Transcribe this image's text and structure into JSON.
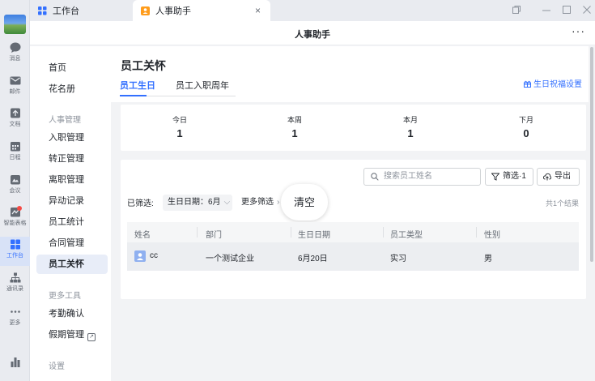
{
  "rail": {
    "items": [
      {
        "label": "消息",
        "icon": "chat-bubble-icon"
      },
      {
        "label": "邮件",
        "icon": "mail-icon"
      },
      {
        "label": "文档",
        "icon": "doc-icon"
      },
      {
        "label": "日程",
        "icon": "calendar-icon"
      },
      {
        "label": "会议",
        "icon": "video-icon"
      },
      {
        "label": "智能表格",
        "icon": "sheet-icon"
      },
      {
        "label": "工作台",
        "icon": "grid-icon",
        "active": true
      },
      {
        "label": "通讯录",
        "icon": "org-icon"
      },
      {
        "label": "更多",
        "icon": "more-dots-icon"
      }
    ]
  },
  "tabs": {
    "inactive_label": "工作台",
    "active_label": "人事助手",
    "close_symbol": "×"
  },
  "window": {
    "title": "人事助手",
    "more_symbol": "···"
  },
  "sidebar": {
    "home": "首页",
    "roster": "花名册",
    "group_hr": "人事管理",
    "onboarding": "入职管理",
    "regularization": "转正管理",
    "resignation": "离职管理",
    "changes": "异动记录",
    "statistics": "员工统计",
    "contracts": "合同管理",
    "care": "员工关怀",
    "group_tools": "更多工具",
    "attendance": "考勤确认",
    "leave": "假期管理",
    "group_settings": "设置"
  },
  "main": {
    "page_title": "员工关怀",
    "tab_birthday": "员工生日",
    "tab_anniversary": "员工入职周年",
    "greeting_settings": "生日祝福设置",
    "stats": [
      {
        "label": "今日",
        "value": "1"
      },
      {
        "label": "本周",
        "value": "1"
      },
      {
        "label": "本月",
        "value": "1"
      },
      {
        "label": "下月",
        "value": "0"
      }
    ],
    "search_placeholder": "搜索员工姓名",
    "filter_button": "筛选·1",
    "export_button": "导出",
    "filtered_label": "已筛选:",
    "filter_chip": "生日日期：6月",
    "more_filters": "更多筛选",
    "clear_label": "清空",
    "result_count": "共1个结果",
    "columns": [
      "姓名",
      "部门",
      "生日日期",
      "员工类型",
      "性别"
    ],
    "rows": [
      {
        "name": "cc",
        "dept": "一个测试企业",
        "birthday": "6月20日",
        "type": "实习",
        "gender": "男"
      }
    ]
  },
  "colors": {
    "accent": "#3370ff",
    "alert_dot": "#f54a45"
  }
}
